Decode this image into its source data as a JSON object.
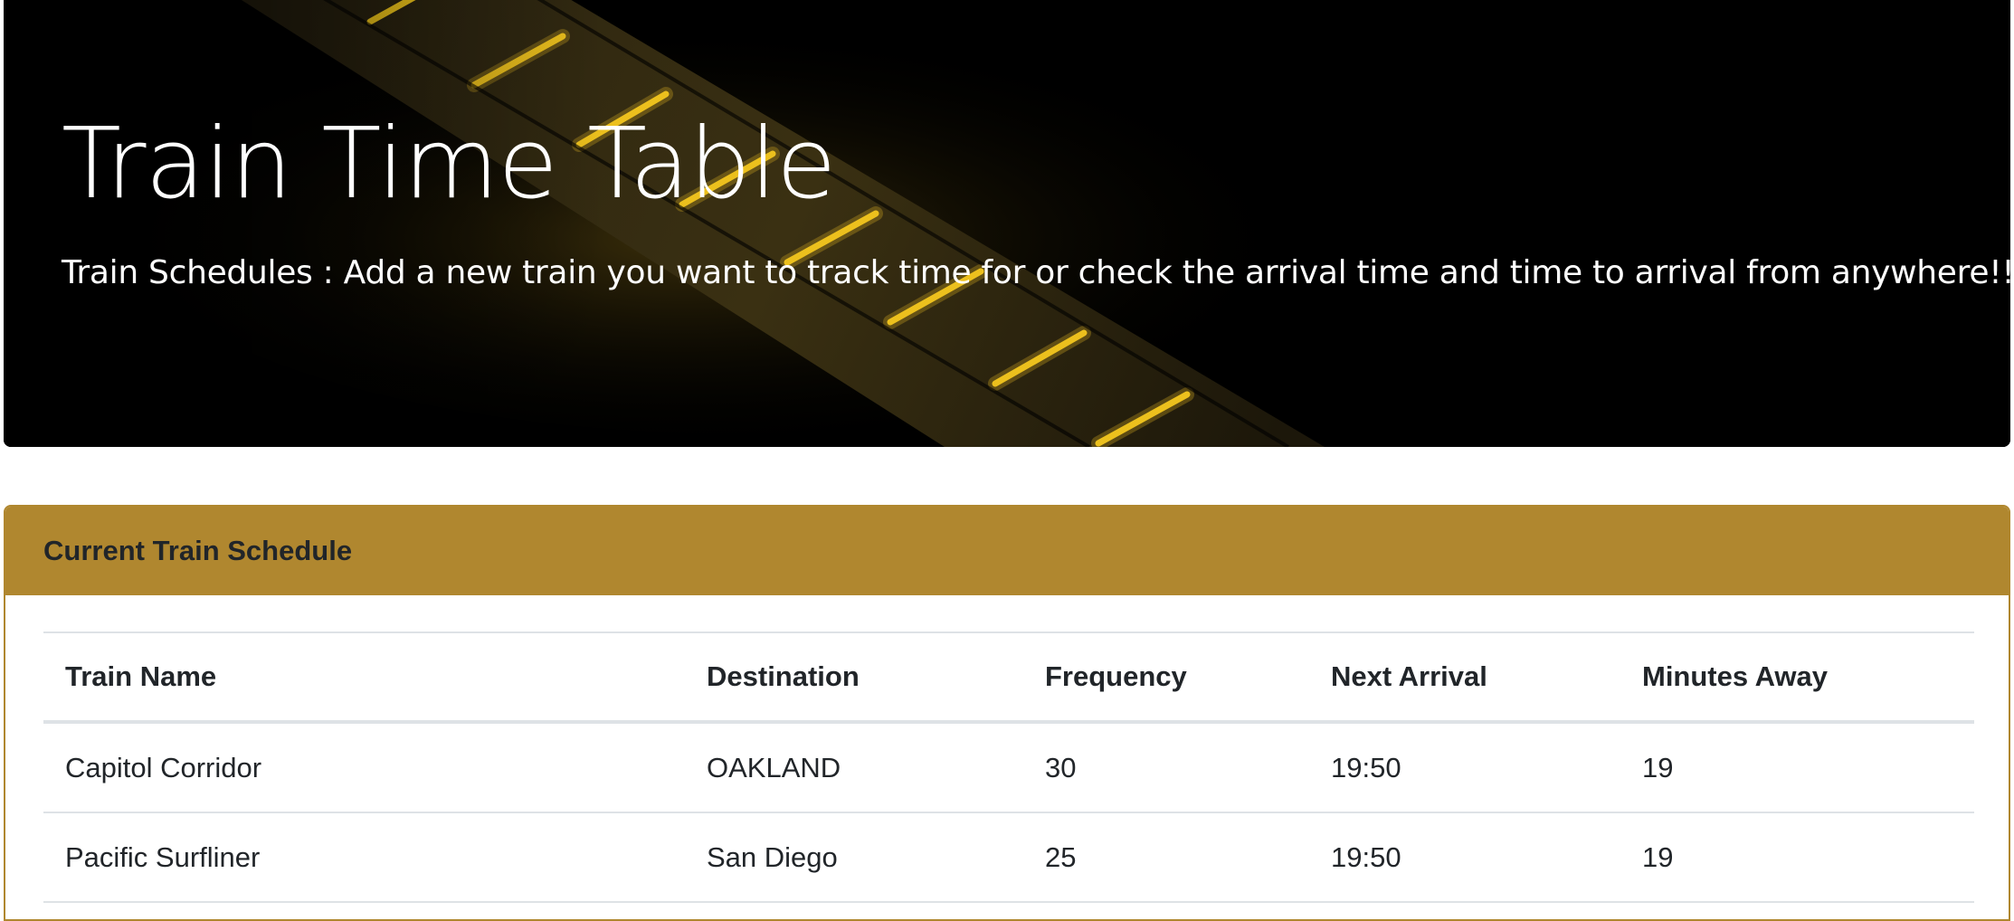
{
  "hero": {
    "title": "Train Time Table",
    "lead": "Train Schedules : Add a new train you want to track time for or check the arrival time and time to arrival from anywhere!!"
  },
  "schedule": {
    "header": "Current Train Schedule",
    "columns": [
      "Train Name",
      "Destination",
      "Frequency",
      "Next Arrival",
      "Minutes Away"
    ],
    "rows": [
      [
        "Capitol Corridor",
        "OAKLAND",
        "30",
        "19:50",
        "19"
      ],
      [
        "Pacific Surfliner",
        "San Diego",
        "25",
        "19:50",
        "19"
      ]
    ]
  },
  "colors": {
    "accent": "#b0872f",
    "hero_background": "#000000",
    "track_light": "#ffd21c"
  }
}
